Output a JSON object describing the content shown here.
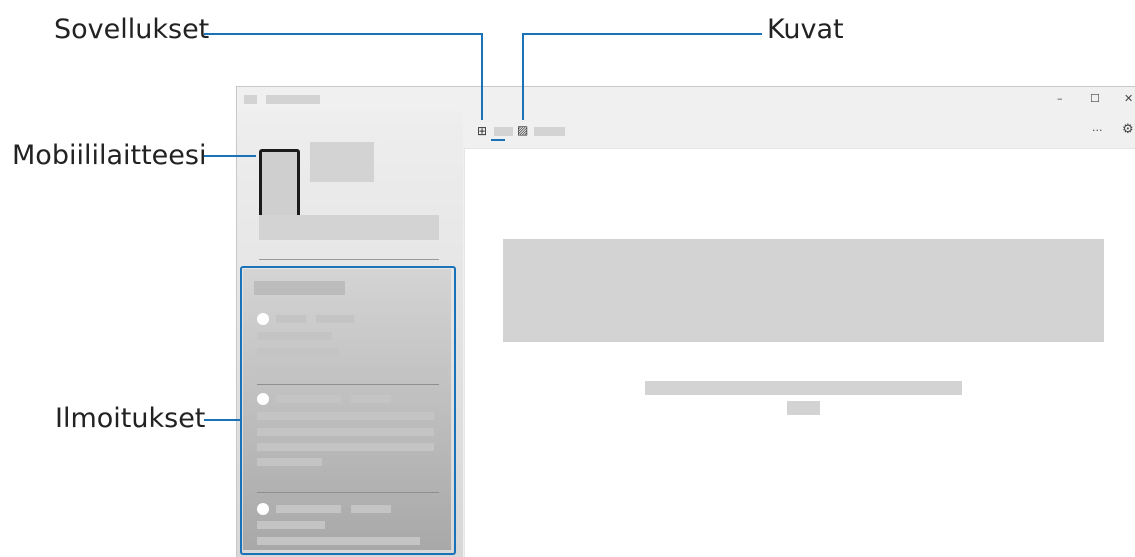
{
  "callouts": {
    "apps": "Sovellukset",
    "photos": "Kuvat",
    "device": "Mobiililaitteesi",
    "notifications": "Ilmoitukset"
  },
  "window": {
    "minimize": "–",
    "maximize": "☐",
    "close": "✕",
    "more": "···",
    "settings": "⚙"
  },
  "tabs": {
    "apps_icon": "apps-grid-icon",
    "photos_icon": "photos-icon"
  },
  "colors": {
    "accent": "#1a73b8",
    "placeholder": "#d3d3d3"
  }
}
